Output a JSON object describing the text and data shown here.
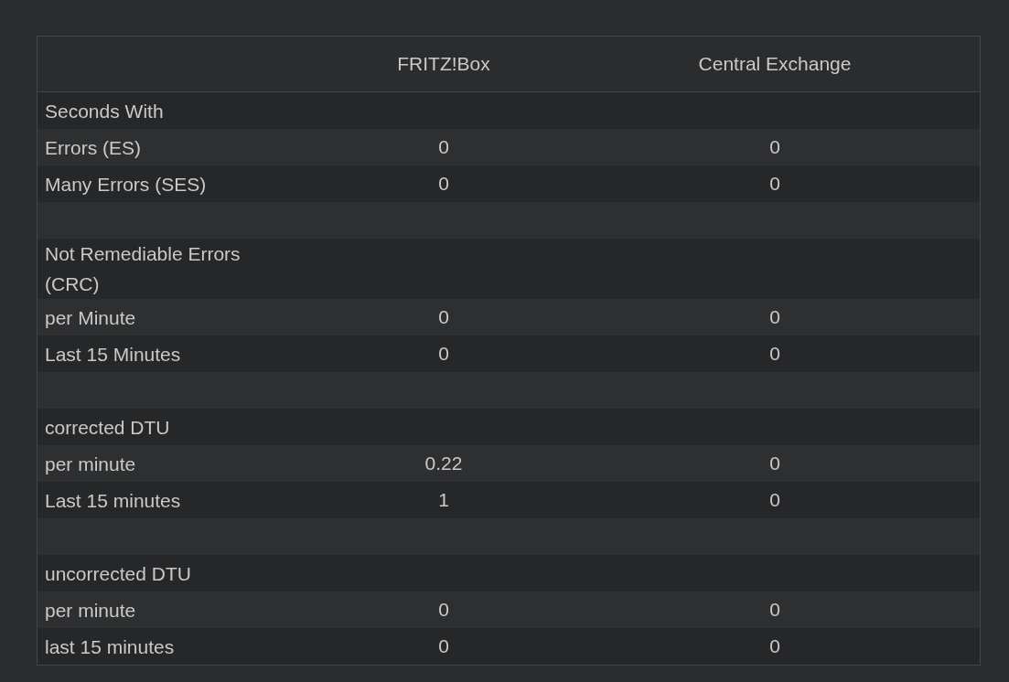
{
  "table": {
    "columns": [
      "FRITZ!Box",
      "Central Exchange"
    ],
    "rows": [
      {
        "kind": "heading",
        "label": "Seconds With"
      },
      {
        "kind": "data",
        "label": "Errors (ES)",
        "values": [
          "0",
          "0"
        ]
      },
      {
        "kind": "data",
        "label": "Many Errors (SES)",
        "values": [
          "0",
          "0"
        ]
      },
      {
        "kind": "spacer"
      },
      {
        "kind": "heading",
        "label": "Not Remediable Errors (CRC)"
      },
      {
        "kind": "data",
        "label": "per Minute",
        "values": [
          "0",
          "0"
        ]
      },
      {
        "kind": "data",
        "label": "Last 15 Minutes",
        "values": [
          "0",
          "0"
        ]
      },
      {
        "kind": "spacer"
      },
      {
        "kind": "heading",
        "label": "corrected DTU"
      },
      {
        "kind": "data",
        "label": "per minute",
        "values": [
          "0.22",
          "0"
        ]
      },
      {
        "kind": "data",
        "label": "Last 15 minutes",
        "values": [
          "1",
          "0"
        ]
      },
      {
        "kind": "spacer"
      },
      {
        "kind": "heading",
        "label": "uncorrected DTU"
      },
      {
        "kind": "data",
        "label": "per minute",
        "values": [
          "0",
          "0"
        ]
      },
      {
        "kind": "data",
        "label": "last 15 minutes",
        "values": [
          "0",
          "0"
        ]
      }
    ]
  }
}
